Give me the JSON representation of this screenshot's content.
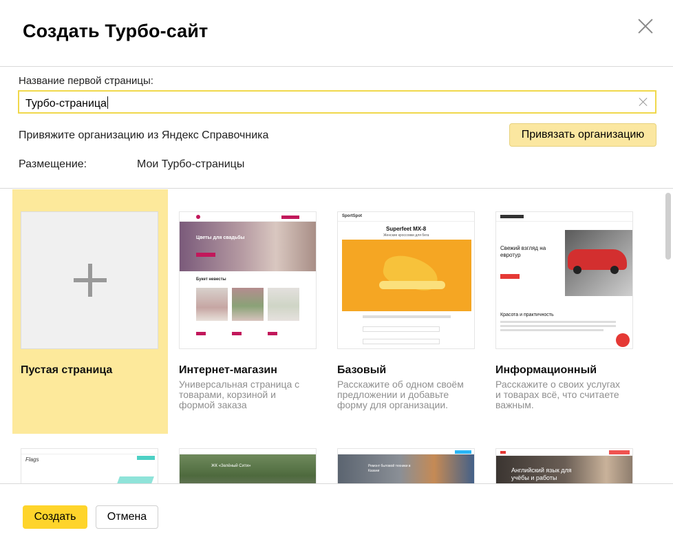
{
  "dialog": {
    "title": "Создать Турбо-сайт"
  },
  "form": {
    "page_name_label": "Название первой страницы:",
    "page_name_value": "Турбо-страница",
    "org_text": "Привяжите организацию из Яндекс Справочника",
    "org_button": "Привязать организацию",
    "placement_label": "Размещение:",
    "placement_value": "Мои Турбо-страницы"
  },
  "templates": [
    {
      "title": "Пустая страница",
      "desc": "",
      "selected": true
    },
    {
      "title": "Интернет-магазин",
      "desc": "Универсальная страница с товарами, корзиной и формой заказа"
    },
    {
      "title": "Базовый",
      "desc": "Расскажите об одном своём предложении и добавьте форму для организации."
    },
    {
      "title": "Информационный",
      "desc": "Расскажите о своих услугах и товарах всё, что считаете важным."
    }
  ],
  "thumbs": {
    "shop": {
      "hero": "Цветы для свадьбы",
      "section": "Букет невесты"
    },
    "basic": {
      "brand": "SportSpot",
      "headline": "Superfeet MX-8",
      "sub": "Женские кроссовки для бега"
    },
    "info": {
      "hero": "Свежий взгляд на евротур",
      "section": "Красота и практичность"
    },
    "row2_flags": {
      "brand": "Flags"
    },
    "row2_estate": {
      "hero": "ЖК «Зелёный Сити»"
    },
    "row2_course": {
      "hero": "Ремонт бытовой техники в Казани"
    },
    "row2_english": {
      "hero": "Английский язык для учёбы и работы"
    }
  },
  "footer": {
    "create": "Создать",
    "cancel": "Отмена"
  },
  "colors": {
    "accent_yellow": "#fed42b",
    "selected_card": "#fde99b",
    "input_border": "#f0d84b"
  }
}
